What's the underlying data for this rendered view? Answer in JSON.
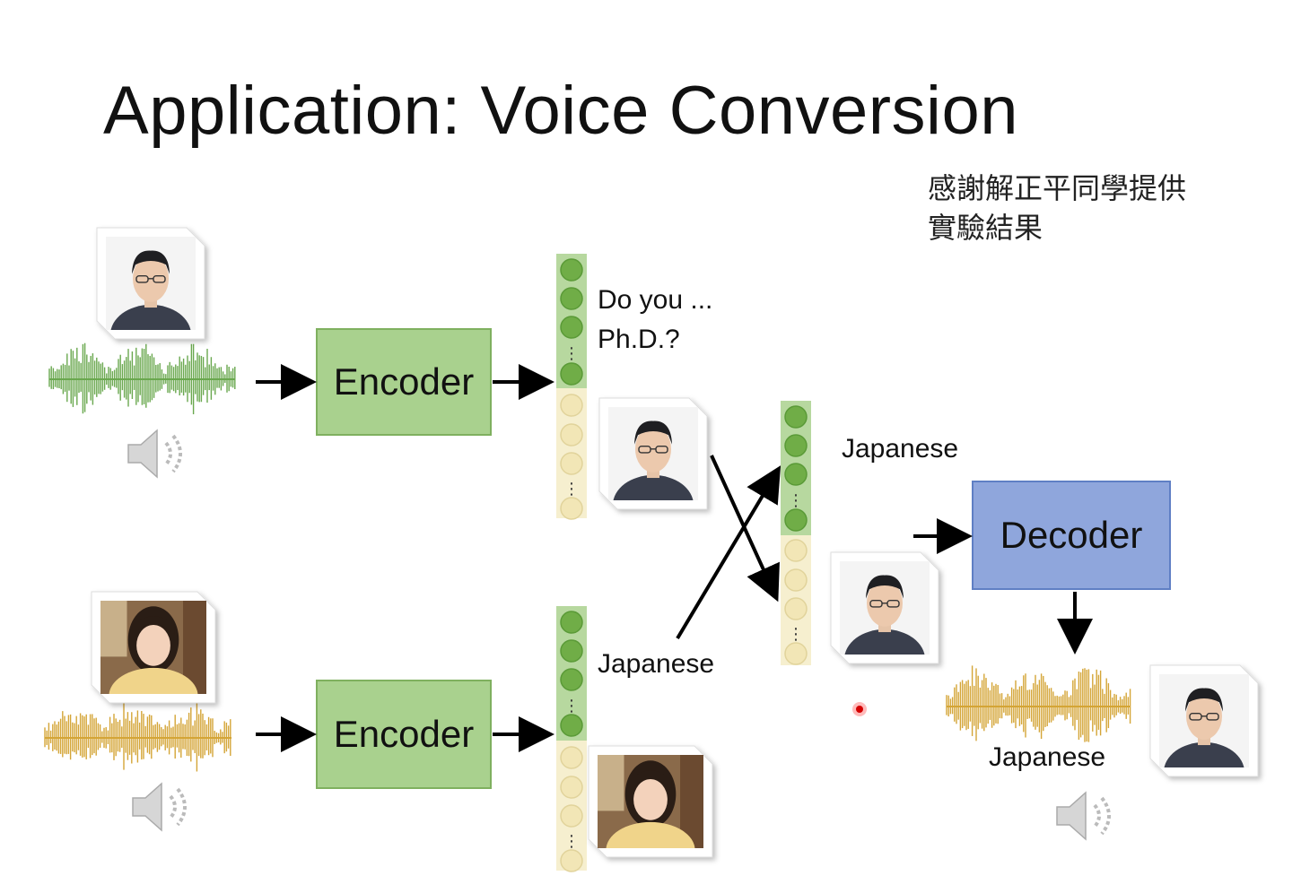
{
  "title": "Application: Voice Conversion",
  "credit": [
    "感謝解正平同學提供",
    "實驗結果"
  ],
  "encoder_top_label": "Encoder",
  "encoder_bottom_label": "Encoder",
  "decoder_label": "Decoder",
  "content_label_top": [
    "Do you ...",
    "Ph.D.?"
  ],
  "content_label_bottom": "Japanese",
  "mixed_content_label": "Japanese",
  "output_label": "Japanese",
  "colors": {
    "encoder": "#a9d18e",
    "decoder": "#8fa6dc",
    "content_dim": "#70ad47",
    "speaker_dim": "#f2e6b6",
    "wave_male": "#6aa84f",
    "wave_female": "#d4a537"
  },
  "icons": {
    "speaker": "speaker-icon",
    "face_male": "male-face-icon",
    "face_female": "female-face-icon",
    "waveform": "waveform-icon"
  }
}
